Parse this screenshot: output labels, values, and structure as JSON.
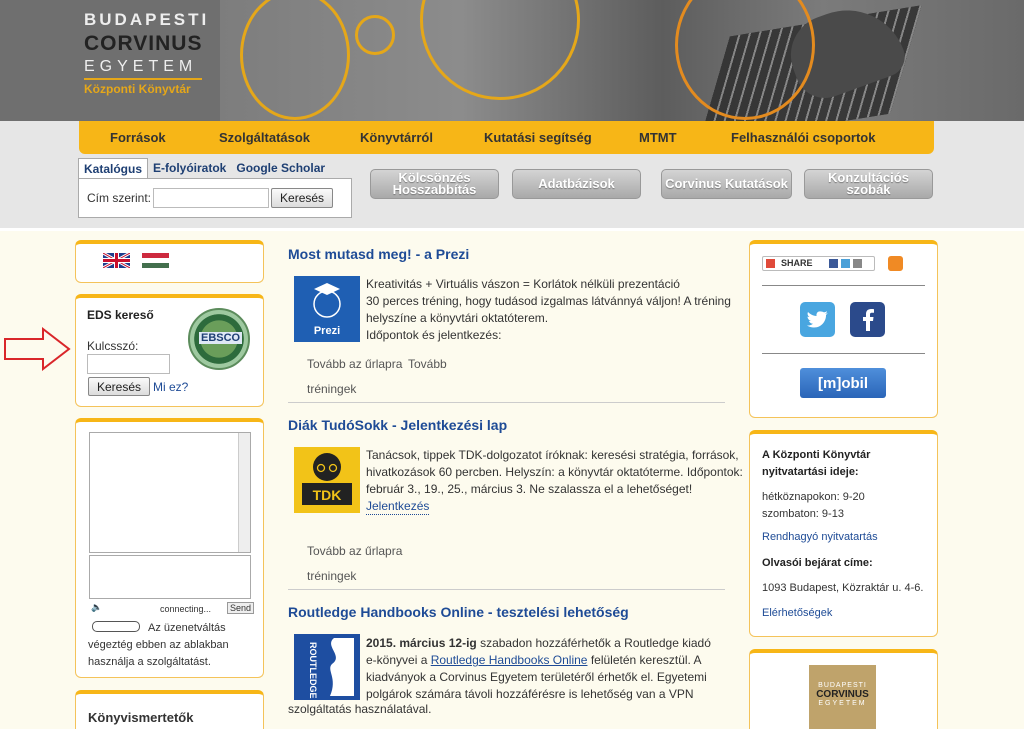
{
  "header": {
    "logo_line1": "BUDAPESTI",
    "logo_line2": "CORVINUS",
    "logo_line3": "EGYETEM",
    "logo_line4": "Központi Könyvtár"
  },
  "nav": {
    "items": [
      "Források",
      "Szolgáltatások",
      "Könyvtárról",
      "Kutatási segítség",
      "MTMT",
      "Felhasználói csoportok"
    ]
  },
  "search": {
    "tabs": [
      "Katalógus",
      "E-folyóiratok",
      "Google Scholar"
    ],
    "field_label": "Cím szerint:",
    "button_label": "Keresés"
  },
  "quick_buttons": {
    "kolcsonzes_line1": "Kölcsönzés",
    "kolcsonzes_line2": "Hosszabbítás",
    "adatbazisok": "Adatbázisok",
    "corvinus_kutatasok": "Corvinus Kutatások",
    "konzultacios_line1": "Konzultációs",
    "konzultacios_line2": "szobák"
  },
  "eds": {
    "title": "EDS kereső",
    "keyword_label": "Kulcsszó:",
    "search_button": "Keresés",
    "help_link": "Mi ez?",
    "logo_text": "EBSCO"
  },
  "chat": {
    "status": "connecting...",
    "send": "Send",
    "notice_line1": "Az üzenetváltás",
    "notice_line2": "végeztég ebben az ablakban",
    "notice_line3": "használja a szolgáltatást."
  },
  "left_bottom": {
    "title": "Könyvismertetők"
  },
  "articles": [
    {
      "title": "Most mutasd meg! - a Prezi",
      "icon_label": "Prezi",
      "lines": [
        "Kreativitás + Virtuális vászon = Korlátok nélküli prezentáció",
        "30 perces tréning, hogy tudásod izgalmas látvánnyá váljon! A tréning",
        "helyszíne a könyvtári oktatóterem.",
        "Időpontok és jelentkezés:"
      ],
      "link1": "Tovább az űrlapra",
      "link2": "Tovább",
      "link3": "tréningek"
    },
    {
      "title": "Diák TudóSokk - Jelentkezési lap",
      "icon_label": "TDK",
      "lines": [
        "Tanácsok, tippek TDK-dolgozatot íróknak: keresési stratégia, források,",
        "hivatkozások 60 percben. Helyszín: a könyvtár oktatóterme. Időpontok:",
        "február 3., 19., 25., március 3. Ne szalassza el a lehetőséget!"
      ],
      "inline_link": "Jelentkezés",
      "link1": "Tovább az űrlapra",
      "link3": "tréningek"
    },
    {
      "title": "Routledge Handbooks Online - tesztelési lehetőség",
      "icon_label": "ROUTLEDGE",
      "bold_date": "2015. március 12-ig",
      "line1_rest": " szabadon hozzáférhetők a Routledge kiadó",
      "line2_pre": "e-könyvei a ",
      "line2_link": "Routledge Handbooks Online",
      "line2_post": " felületén keresztül. A",
      "line3": "kiadványok a Corvinus Egyetem területéről érhetők el. Egyetemi",
      "line4": "polgárok számára távoli hozzáférésre is lehetőség van a VPN",
      "line5": "szolgáltatás használatával."
    }
  ],
  "right": {
    "share_label": "SHARE",
    "mobil_button": "[m]obil",
    "hours_title1": "A Központi Könyvtár",
    "hours_title2": "nyitvatartási ideje:",
    "weekday": "hétköznapokon: 9-20",
    "saturday": "szombaton: 9-13",
    "irregular_link": "Rendhagyó nyitvatartás",
    "entrance_title": "Olvasói bejárat címe:",
    "address": "1093 Budapest, Közraktár u. 4-6.",
    "access_link": "Elérhetőségek",
    "logo_line1": "BUDAPESTI",
    "logo_line2": "CORVINUS",
    "logo_line3": "EGYETEM"
  },
  "colors": {
    "accent": "#f7b617",
    "link": "#1e4b96",
    "arrow": "#d9262a"
  }
}
